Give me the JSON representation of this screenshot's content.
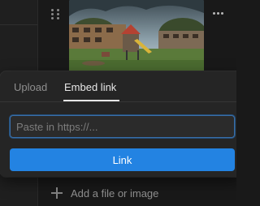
{
  "popover": {
    "tabs": [
      {
        "label": "Upload",
        "active": false
      },
      {
        "label": "Embed link",
        "active": true
      }
    ],
    "input": {
      "placeholder": "Paste in https://...",
      "value": ""
    },
    "button_label": "Link"
  },
  "add_block": {
    "label": "Add a file or image"
  },
  "image": {
    "icon": "playground-image"
  },
  "colors": {
    "accent": "#2383e2",
    "background": "#191919",
    "popover": "#252525"
  }
}
